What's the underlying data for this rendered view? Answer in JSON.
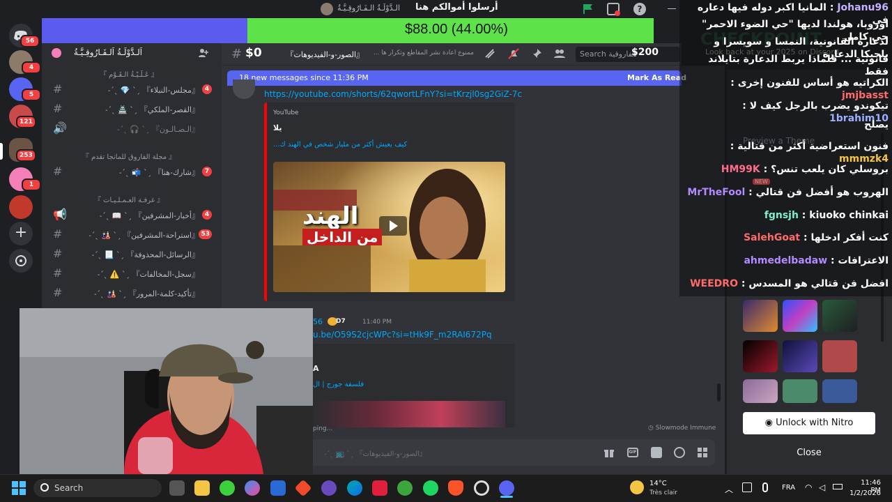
{
  "titlebar": {
    "title": "أرسلوا أموالكم هنا",
    "server_tag": "الـدَّوْلَـةُ الـفَـارُوقِـيَّـةُ"
  },
  "rail": {
    "badges": [
      "56",
      "4",
      "5",
      "121",
      "253",
      "1"
    ]
  },
  "goal": {
    "amount": "$88.00 (44.00%)",
    "progress": 0.44
  },
  "sidebar": {
    "server_name": "اَلـدَّوْلَـةُ اَلـفَـارُوقِـيَّـةُ",
    "categories": [
      "『 عَـلَـيْـةُ الـقَـوْم 』",
      "『 مجلة الفاروق للمانجا تقدم 』",
      "『 غرفـة العـمـلـيـات 』"
    ],
    "channels": [
      {
        "label": "『مجلس-النبلاء』  ˏˋ 💎 ˎˊ˗",
        "badge": "4"
      },
      {
        "label": "『القصر-الملكي』  ˏˋ 🏯 ˎˊ˗",
        "badge": ""
      },
      {
        "label": "『الـصـالـون』  ˏˋ 🎧 ˎˊ˗",
        "badge": ""
      },
      {
        "label": "『شارك-هنا』  ˏˋ 📬 ˎˊ˗",
        "badge": "7"
      },
      {
        "label": "『أخبار-المشرفين』  ˏˋ 📖 ˎˊ˗",
        "badge": "4"
      },
      {
        "label": "『استراحة-المشرفين』  ˏˋ 🎎 ˎˊ˗",
        "badge": "53"
      },
      {
        "label": "『الرسائل-المحذوفة』  ˏˋ 📃 ˎˊ˗",
        "badge": ""
      },
      {
        "label": "『سجل-المخالفات』  ˏˋ ⚠️ ˎˊ˗",
        "badge": ""
      },
      {
        "label": "『تأكيد-كلمة-المرور』  ˏˋ 🎎 ˎˊ˗",
        "badge": ""
      }
    ]
  },
  "chat_header": {
    "channel": "『الصور-و-الفيديوهات』 ˏˋ 📺 ˎˊ˗",
    "topic": "ممنوع اعادة نشر المقاطع وتكرار ها ...",
    "search_placeholder": "Search الفاروقية",
    "left_amount": "$0",
    "right_amount": "$200"
  },
  "banner": {
    "text": "18 new messages since 11:36 PM",
    "action": "Mark As Read"
  },
  "messages": {
    "link1": "https://youtube.com/shorts/62qwortLFnY?si=tKrzjl0sg2GiZ-7c",
    "embed_provider": "YouTube",
    "embed_author": "يلا",
    "embed_title": "كيف يعيش أكثر من مليار شخص في الهند ك...",
    "thumb_caption_1": "الهند",
    "thumb_caption_2": "من الداخل",
    "msg2_tag": "D7",
    "msg2_time": "11:40 PM",
    "msg2_prefix": "56",
    "link2": "u.be/O59S2cjcWPc?si=tHk9F_m2RAI672Pq",
    "msg2_embed_author": "A",
    "msg2_embed_title": "فلسفة جورج | ال",
    "typing": "ping...",
    "slowmode": "Slowmode Immune"
  },
  "composer": {
    "placeholder": "『الصور-و-الفيديوهات』 ˏˋ 📺 ˎˊ˗"
  },
  "sidechat": {
    "messages": [
      {
        "user": "Johanu96",
        "text": "المانيا اكبر دوله فيها دعاره في",
        "color": "#c7b2ff"
      },
      {
        "user": "",
        "text": "اوروبا، هولندا لديها \"حي الضوء الاحمر\" حي كامل",
        "color": "#ffffff"
      },
      {
        "user": "",
        "text": "لدعارة القانونية، النمسا و سويسرا و بلجيكا الدعارة",
        "color": "#ffffff"
      },
      {
        "user": "",
        "text": "قانونية ... فلماذا يربط الدعارة بتايلاند فقط",
        "color": "#ffffff"
      },
      {
        "user": "jmjbasst",
        "text": "الكراتيه هو أساس للفنون إخرى",
        "color": "#ff6b6b"
      },
      {
        "user": "1brahim10",
        "text": "تيكوندو يضرب بالرجل كيف لا",
        "color": "#9bb0ff"
      },
      {
        "user": "",
        "text": "يصلح",
        "color": "#ffffff"
      },
      {
        "user": "mmmzk4",
        "text": "فنون استعراضية أكثر من قتالية",
        "color": "#f5c542"
      },
      {
        "user": "HM99K",
        "text": "بروسلي كان يلعب تنس؟",
        "color": "#ff6b8a"
      },
      {
        "user": "MrTheFool",
        "text": "الهروب هو أفضل فن قتالي",
        "color": "#b38bff"
      },
      {
        "user": "fgnsjh",
        "text": "kiuoko chinkai",
        "color": "#7ef0c7"
      },
      {
        "user": "SalehGoat",
        "text": "كنت أفكر ادخلها",
        "color": "#ff6b6b"
      },
      {
        "user": "ahmedelbadaw",
        "text": "الاعترافات",
        "color": "#b38bff"
      },
      {
        "user": "WEEDRO",
        "text": "افضل فن قتالي هو المسدس",
        "color": "#ff6b6b"
      }
    ],
    "bg_words": [
      "CHECKPOINT",
      "Look back at your 2025 on Discord",
      "Preview a Theme",
      "NEW"
    ]
  },
  "nitro": {
    "unlock_label": "Unlock with Nitro",
    "close_label": "Close"
  },
  "taskbar": {
    "search_label": "Search",
    "weather_temp": "14°C",
    "weather_desc": "Très clair",
    "lang": "FRA",
    "time": "11:46 PM",
    "date": "1/2/2026"
  }
}
